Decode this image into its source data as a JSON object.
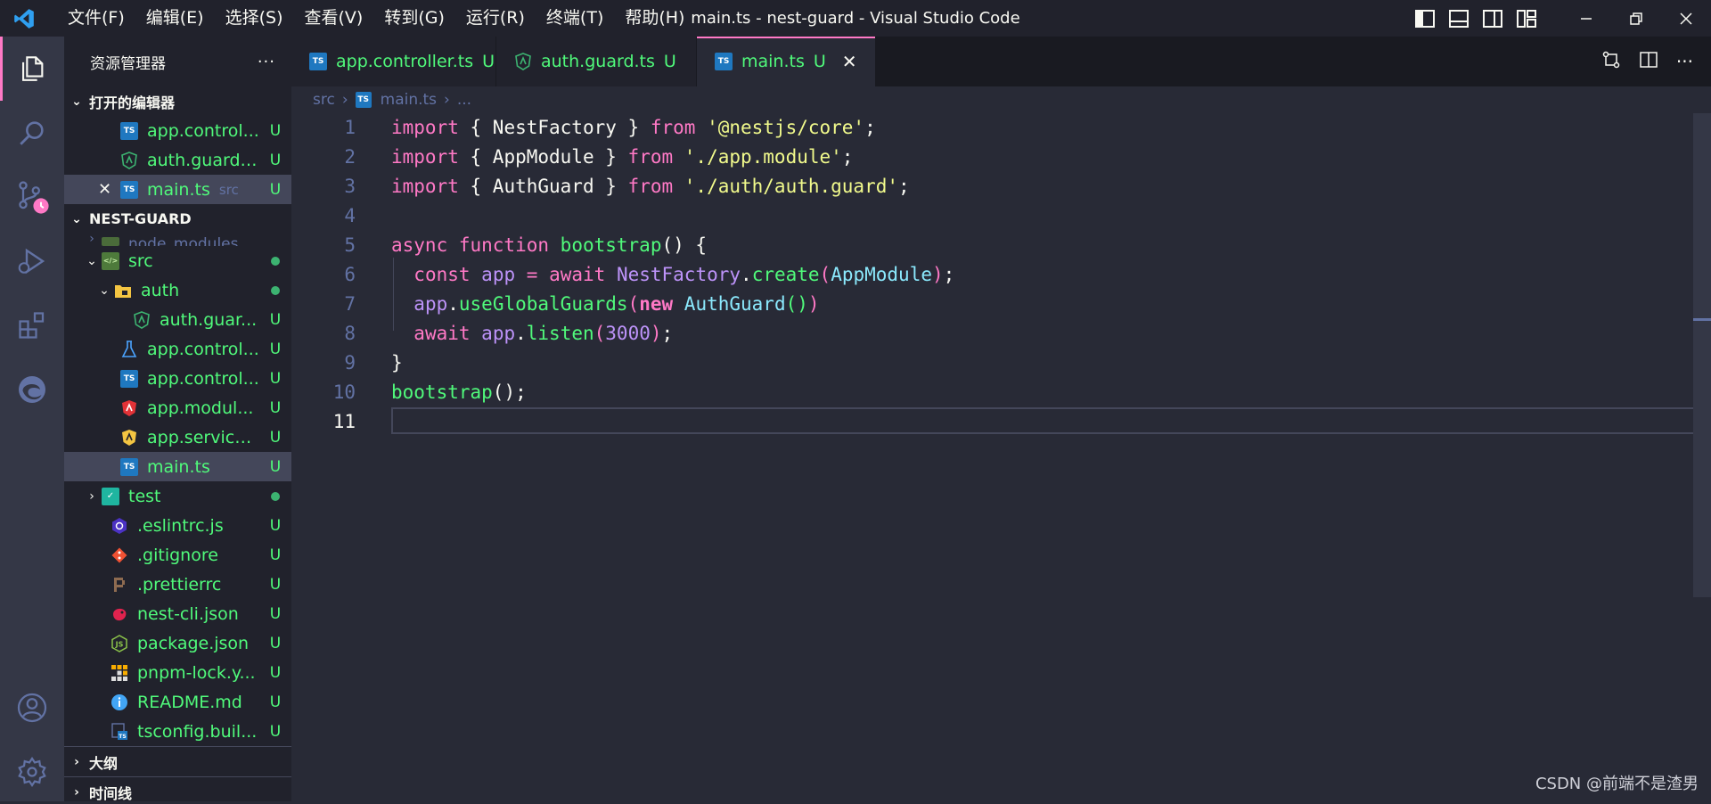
{
  "titlebar": {
    "menu": [
      "文件(F)",
      "编辑(E)",
      "选择(S)",
      "查看(V)",
      "转到(G)",
      "运行(R)",
      "终端(T)",
      "帮助(H)"
    ],
    "title": "main.ts - nest-guard - Visual Studio Code"
  },
  "activity": {
    "icons": [
      "files-icon",
      "search-icon",
      "source-control-icon",
      "run-debug-icon",
      "extensions-icon",
      "edge-icon",
      "account-icon",
      "settings-icon"
    ]
  },
  "sidebar": {
    "title": "资源管理器",
    "more": "···",
    "open_editors": {
      "label": "打开的编辑器",
      "items": [
        {
          "name": "app.control...",
          "status": "U"
        },
        {
          "name": "auth.guard....",
          "status": "U"
        },
        {
          "name": "main.ts",
          "path": "src",
          "status": "U"
        }
      ]
    },
    "project": {
      "label": "NEST-GUARD",
      "node_modules": "node_modules",
      "src": "src",
      "auth": "auth",
      "auth_guard": "auth.guar...",
      "files": [
        {
          "name": "app.control...",
          "status": "U"
        },
        {
          "name": "app.control...",
          "status": "U"
        },
        {
          "name": "app.modul...",
          "status": "U"
        },
        {
          "name": "app.service.ts",
          "status": "U"
        },
        {
          "name": "main.ts",
          "status": "U"
        }
      ],
      "test": "test",
      "root_files": [
        {
          "name": ".eslintrc.js",
          "status": "U"
        },
        {
          "name": ".gitignore",
          "status": "U"
        },
        {
          "name": ".prettierrc",
          "status": "U"
        },
        {
          "name": "nest-cli.json",
          "status": "U"
        },
        {
          "name": "package.json",
          "status": "U"
        },
        {
          "name": "pnpm-lock.y...",
          "status": "U"
        },
        {
          "name": "README.md",
          "status": "U"
        },
        {
          "name": "tsconfig.buil...",
          "status": "U"
        }
      ],
      "auth_guard_status": "U"
    },
    "outline": "大纲",
    "timeline": "时间线"
  },
  "tabs": [
    {
      "label": "app.controller.ts",
      "status": "U"
    },
    {
      "label": "auth.guard.ts",
      "status": "U"
    },
    {
      "label": "main.ts",
      "status": "U"
    }
  ],
  "breadcrumb": {
    "folder": "src",
    "file": "main.ts",
    "more": "..."
  },
  "editor": {
    "line_numbers": [
      "1",
      "2",
      "3",
      "4",
      "5",
      "6",
      "7",
      "8",
      "9",
      "10",
      "11"
    ]
  },
  "watermark": "CSDN @前端不是渣男",
  "colors": {
    "background": "#282a36",
    "accent": "#ff79c6",
    "green": "#50fa7b"
  }
}
